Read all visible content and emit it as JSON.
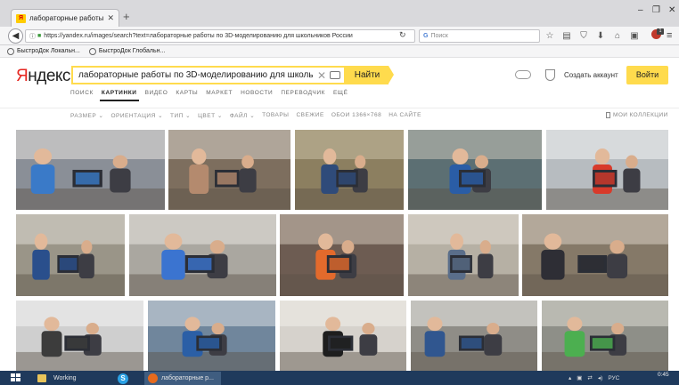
{
  "browser": {
    "tab_title": "лабораторные работы п...",
    "tab_close": "✕",
    "new_tab": "+",
    "favicon_letter": "Я",
    "window_minimize": "–",
    "window_maximize": "❐",
    "window_close": "✕",
    "back": "◀",
    "url": "https://yandex.ru/images/search?text=лабораторные работы по 3D-моделированию для школьников России",
    "info_icon": "ⓘ",
    "lock_icon": "🔒",
    "reload": "↻",
    "search_placeholder": "Поиск",
    "search_engine": "G",
    "toolbar_icons": [
      "☆",
      "▤",
      "⛉",
      "⬇",
      "⌂",
      "▣"
    ],
    "ext_red": "●",
    "ext_badge": "1",
    "menu": "≡"
  },
  "bookmarks": [
    {
      "label": "БыстроДок Локальн..."
    },
    {
      "label": "БыстроДок Глобальн..."
    }
  ],
  "yandex": {
    "logo_first": "Я",
    "logo_rest": "ндекс",
    "query": "лабораторные работы по 3D-моделированию для школь",
    "clear": "✕",
    "search_button": "Найти",
    "create_account": "Создать аккаунт",
    "login_button": "Войти",
    "services": [
      {
        "label": "ПОИСК",
        "active": false
      },
      {
        "label": "КАРТИНКИ",
        "active": true
      },
      {
        "label": "ВИДЕО",
        "active": false
      },
      {
        "label": "КАРТЫ",
        "active": false
      },
      {
        "label": "МАРКЕТ",
        "active": false
      },
      {
        "label": "НОВОСТИ",
        "active": false
      },
      {
        "label": "ПЕРЕВОДЧИК",
        "active": false
      },
      {
        "label": "ЕЩЁ",
        "active": false
      }
    ],
    "filters": [
      "РАЗМЕР ⌄",
      "ОРИЕНТАЦИЯ ⌄",
      "ТИП ⌄",
      "ЦВЕТ ⌄",
      "ФАЙЛ ⌄",
      "ТОВАРЫ",
      "СВЕЖИЕ",
      "ОБОИ 1366×768",
      "НА САЙТЕ"
    ],
    "my_collections": "МОИ КОЛЛЕКЦИИ"
  },
  "images": [
    {
      "name": "image-kids-laptop-3d-model",
      "bg": "#8a8f97",
      "accent": "#3a7ac8",
      "alt": "#e7e3df"
    },
    {
      "name": "image-classroom-students",
      "bg": "#7d6e5e",
      "accent": "#b48a6e",
      "alt": "#d8d3cb"
    },
    {
      "name": "image-teacher-computers",
      "bg": "#8c7f60",
      "accent": "#2f4b7a",
      "alt": "#c9c0a4"
    },
    {
      "name": "image-3d-printer-group",
      "bg": "#5c6f73",
      "accent": "#2a5da6",
      "alt": "#c8c4b8"
    },
    {
      "name": "image-boy-robotics",
      "bg": "#b7bcc0",
      "accent": "#d83a2a",
      "alt": "#f2f2f2"
    },
    {
      "name": "image-boy-3d-printer",
      "bg": "#9a9588",
      "accent": "#2a4f8c",
      "alt": "#e0ddd5"
    },
    {
      "name": "image-printed-model-blue",
      "bg": "#aaa7a0",
      "accent": "#3b74d0",
      "alt": "#e8e6e0"
    },
    {
      "name": "image-kids-workbench-orange",
      "bg": "#6d5c52",
      "accent": "#e36a2c",
      "alt": "#cfc4b7"
    },
    {
      "name": "image-class-assembly",
      "bg": "#b6b0a4",
      "accent": "#5a6e8a",
      "alt": "#e1ddd3"
    },
    {
      "name": "image-girl-laptop",
      "bg": "#857968",
      "accent": "#2e2e35",
      "alt": "#d9d0c2"
    },
    {
      "name": "image-drawing-screen",
      "bg": "#cfcfcf",
      "accent": "#3c3c3c",
      "alt": "#f4f4f4"
    },
    {
      "name": "image-boys-electronics",
      "bg": "#70869c",
      "accent": "#2b5fa6",
      "alt": "#d7dde2"
    },
    {
      "name": "image-teacher-black-shirt",
      "bg": "#d6d2cc",
      "accent": "#1e1e1e",
      "alt": "#f2efe9"
    },
    {
      "name": "image-3d-printer-machine",
      "bg": "#8f8d87",
      "accent": "#30568f",
      "alt": "#eeeeea"
    },
    {
      "name": "image-printer-green-parts",
      "bg": "#8e8f88",
      "accent": "#4caf50",
      "alt": "#dcdcd4"
    }
  ],
  "taskbar": {
    "folder_label": "Working",
    "skype_letter": "S",
    "firefox_label": "лабораторные р...",
    "tray": [
      "▴",
      "▣",
      "⇄",
      "◂)",
      "РУС"
    ],
    "time": "0:45",
    "date": ""
  }
}
